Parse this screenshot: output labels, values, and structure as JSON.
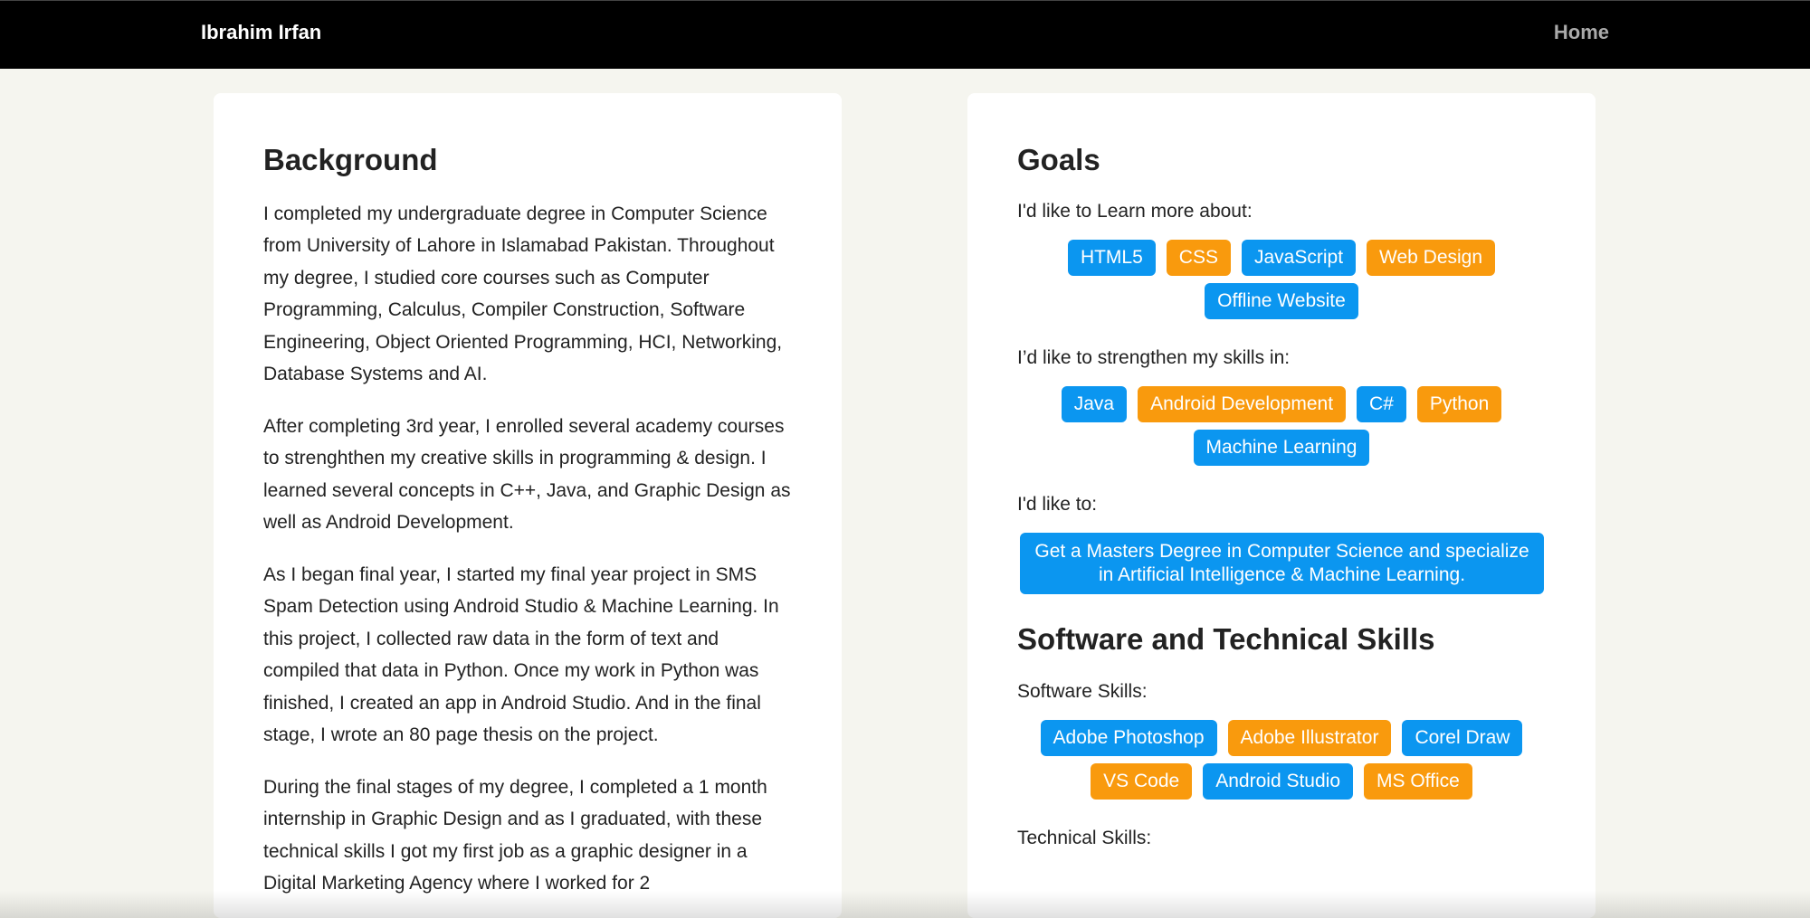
{
  "nav": {
    "brand": "Ibrahim Irfan",
    "home": "Home"
  },
  "background": {
    "title": "Background",
    "paragraphs": [
      "I completed my undergraduate degree in Computer Science from University of Lahore in Islamabad Pakistan. Throughout my degree, I studied core courses such as Computer Programming, Calculus, Compiler Construction, Software Engineering, Object Oriented Programming, HCI, Networking, Database Systems and AI.",
      "After completing 3rd year, I enrolled several academy courses to strenghthen my creative skills in programming & design. I learned several concepts in C++, Java, and Graphic Design as well as Android Development.",
      "As I began final year, I started my final year project in SMS Spam Detection using Android Studio & Machine Learning. In this project, I collected raw data in the form of text and compiled that data in Python. Once my work in Python was finished, I created an app in Android Studio. And in the final stage, I wrote an 80 page thesis on the project.",
      "During the final stages of my degree, I completed a 1 month internship in Graphic Design and as I graduated, with these technical skills I got my first job as a graphic designer in a Digital Marketing Agency where I worked for 2"
    ]
  },
  "goals": {
    "title": "Goals",
    "learn_label": "I'd like to Learn more about:",
    "learn_tags": [
      "HTML5",
      "CSS",
      "JavaScript",
      "Web Design",
      "Offline Website"
    ],
    "strengthen_label": "I’d like to strengthen my skills in:",
    "strengthen_tags": [
      "Java",
      "Android Development",
      "C#",
      "Python",
      "Machine Learning"
    ],
    "like_to_label": "I'd like to:",
    "goal_text": "Get a Masters Degree in Computer Science and specialize in Artificial Intelligence & Machine Learning."
  },
  "skills": {
    "title": "Software and Technical Skills",
    "software_label": "Software Skills:",
    "software_tags": [
      "Adobe Photoshop",
      "Adobe Illustrator",
      "Corel Draw",
      "VS Code",
      "Android Studio",
      "MS Office"
    ],
    "technical_label": "Technical Skills:"
  },
  "colors": {
    "tag_blue": "#0b96f0",
    "tag_orange": "#f99a0d",
    "navbar": "#000000",
    "page_bg": "#f5f5ef"
  }
}
